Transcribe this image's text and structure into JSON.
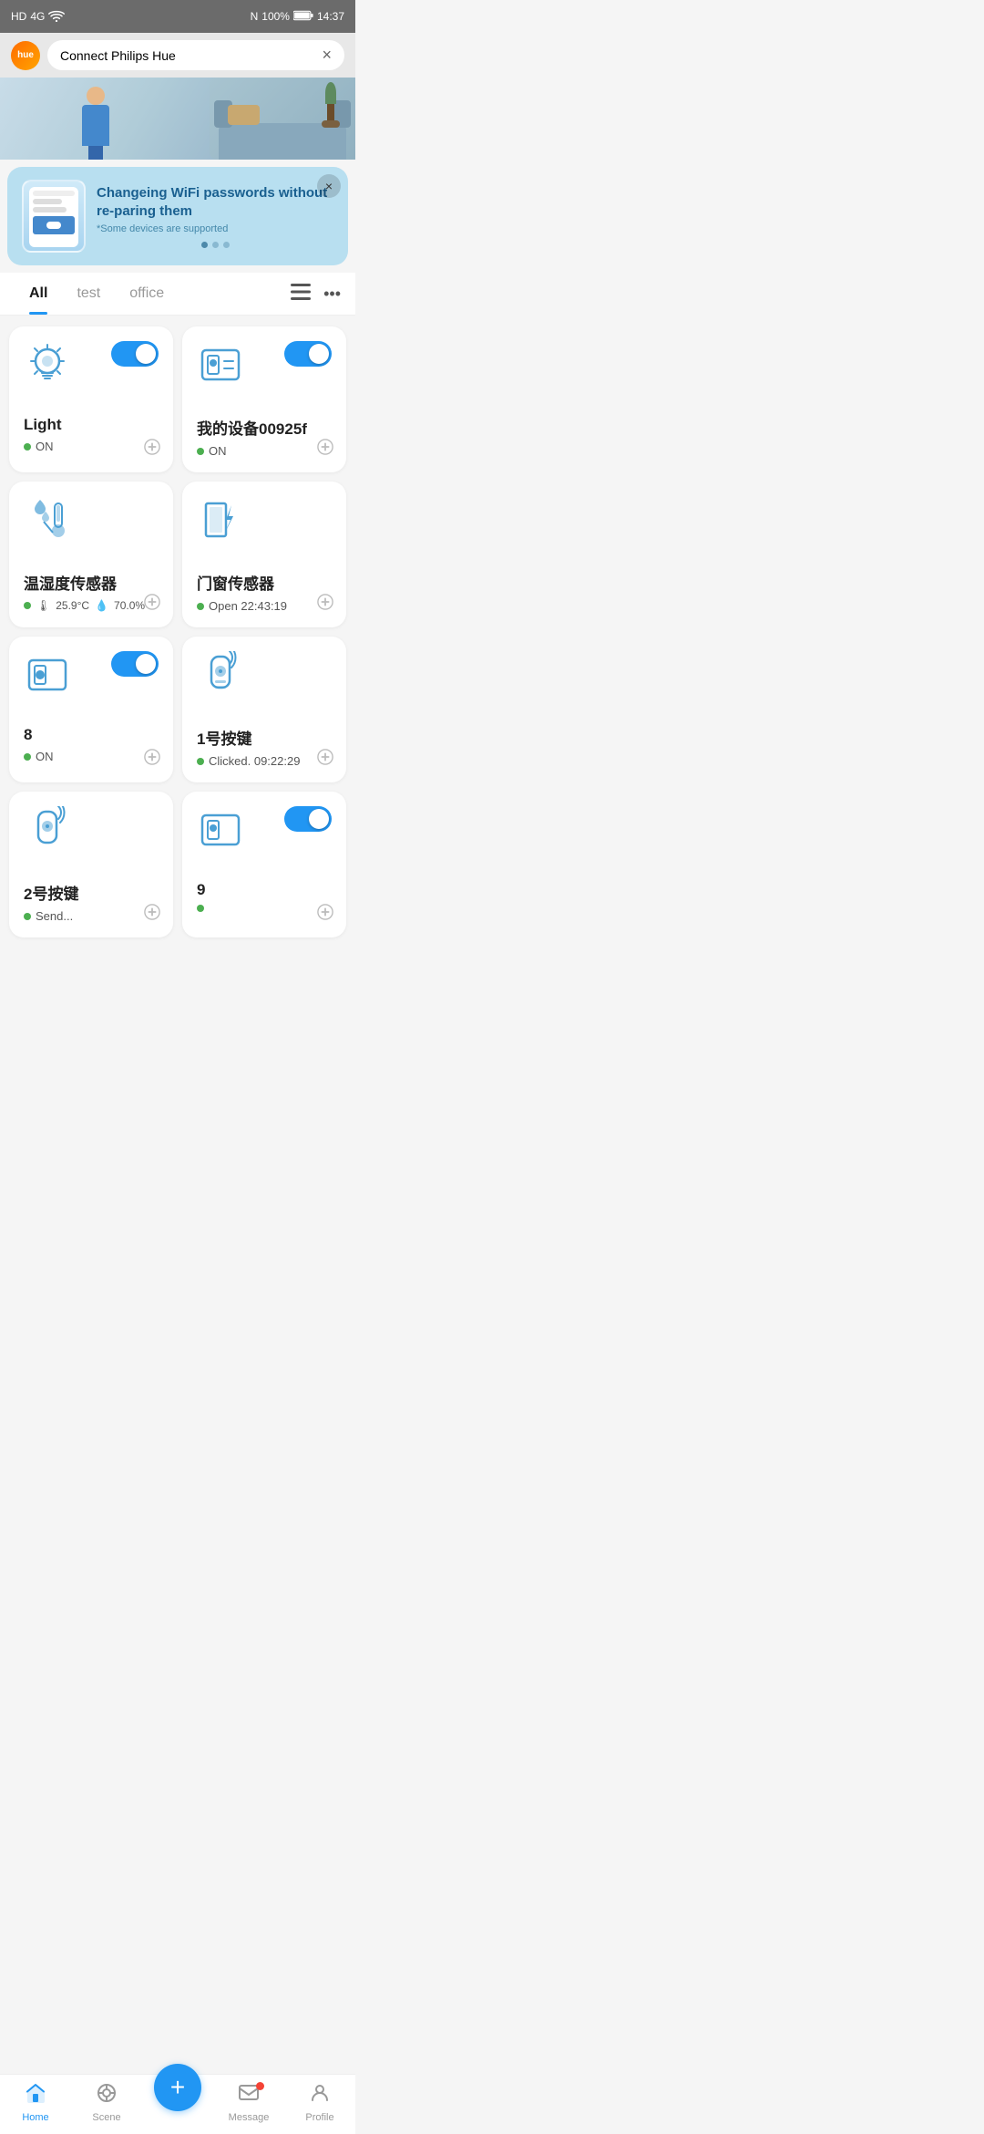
{
  "status_bar": {
    "left": "HD 4G",
    "time": "14:37",
    "battery": "100%"
  },
  "browser": {
    "title": "Connect Philips Hue",
    "close_label": "×"
  },
  "promo": {
    "title": "Changeing WiFi passwords without re-paring them",
    "subtitle": "*Some devices are supported",
    "close_label": "×"
  },
  "tabs": [
    {
      "id": "all",
      "label": "All",
      "active": true
    },
    {
      "id": "test",
      "label": "test",
      "active": false
    },
    {
      "id": "office",
      "label": "office",
      "active": false
    }
  ],
  "devices": [
    {
      "id": "light",
      "name": "Light",
      "status_text": "ON",
      "status": "on",
      "type": "light",
      "toggle": true
    },
    {
      "id": "device_00925f",
      "name": "我的设备00925f",
      "status_text": "ON",
      "status": "on",
      "type": "switch",
      "toggle": true
    },
    {
      "id": "temp_humidity",
      "name": "温湿度传感器",
      "status_text": "25.9°C",
      "humidity": "70.0%",
      "status": "on",
      "type": "sensor"
    },
    {
      "id": "door_sensor",
      "name": "门窗传感器",
      "status_text": "Open 22:43:19",
      "status": "on",
      "type": "door"
    },
    {
      "id": "device_8",
      "name": "8",
      "status_text": "ON",
      "status": "on",
      "type": "switch",
      "toggle": true
    },
    {
      "id": "button_1",
      "name": "1号按键",
      "status_text": "Clicked. 09:22:29",
      "status": "on",
      "type": "button"
    },
    {
      "id": "button_2",
      "name": "2号按键",
      "status_text": "Send...",
      "status": "on",
      "type": "button"
    },
    {
      "id": "device_9",
      "name": "9",
      "status_text": "",
      "status": "on",
      "type": "switch",
      "toggle": true
    }
  ],
  "bottom_nav": [
    {
      "id": "home",
      "label": "Home",
      "active": true
    },
    {
      "id": "scene",
      "label": "Scene",
      "active": false
    },
    {
      "id": "add",
      "label": "+",
      "active": false
    },
    {
      "id": "message",
      "label": "Message",
      "active": false,
      "badge": true
    },
    {
      "id": "profile",
      "label": "Profile",
      "active": false
    }
  ]
}
